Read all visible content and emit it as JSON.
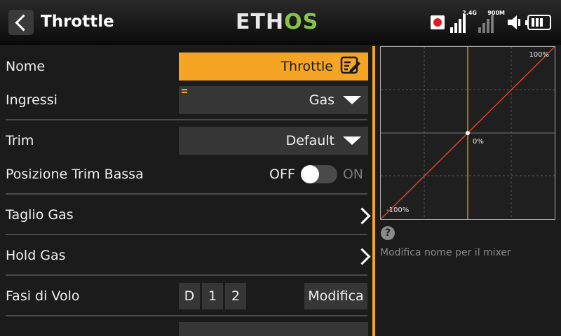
{
  "header": {
    "title": "Throttle",
    "logo_main": "ETH",
    "logo_accent": "OS",
    "signal_rx1_label": "2.4G",
    "signal_rx2_label": "900M"
  },
  "colors": {
    "accent": "#f5a523",
    "logo_green": "#8bc34a",
    "curve": "#e0402a",
    "field_bg": "#363636"
  },
  "form": {
    "nome": {
      "label": "Nome",
      "value": "Throttle"
    },
    "ingressi": {
      "label": "Ingressi",
      "value": "Gas"
    },
    "trim": {
      "label": "Trim",
      "value": "Default"
    },
    "posizione_trim_bassa": {
      "label": "Posizione Trim Bassa",
      "off": "OFF",
      "on": "ON",
      "state": "off"
    },
    "taglio_gas": {
      "label": "Taglio Gas"
    },
    "hold_gas": {
      "label": "Hold Gas"
    },
    "fasi_di_volo": {
      "label": "Fasi di Volo",
      "chips": [
        "D",
        "1",
        "2"
      ],
      "button": "Modifica"
    }
  },
  "graph": {
    "top_right_label": "100%",
    "center_label": "0%",
    "bottom_left_label": "-100%"
  },
  "help": {
    "text": "Modifica nome per il mixer"
  },
  "icons": {
    "back": "chevron-left-icon",
    "edit": "edit-icon",
    "dropdown": "caret-down-icon",
    "help": "help-icon"
  }
}
